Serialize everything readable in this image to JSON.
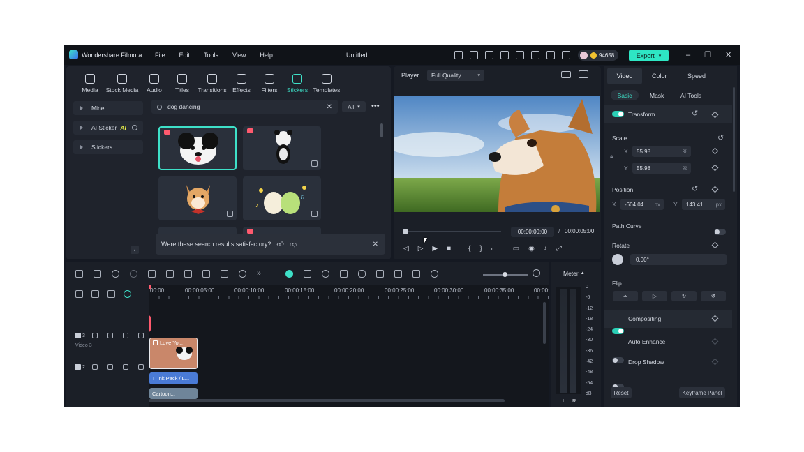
{
  "app": {
    "name": "Wondershare Filmora",
    "doc_title": "Untitled",
    "credits": "94658",
    "export_label": "Export"
  },
  "menu": [
    "File",
    "Edit",
    "Tools",
    "View",
    "Help"
  ],
  "toolbar": [
    {
      "label": "Media",
      "icon": "media-icon"
    },
    {
      "label": "Stock Media",
      "icon": "stock-media-icon"
    },
    {
      "label": "Audio",
      "icon": "audio-icon"
    },
    {
      "label": "Titles",
      "icon": "titles-icon"
    },
    {
      "label": "Transitions",
      "icon": "transitions-icon"
    },
    {
      "label": "Effects",
      "icon": "effects-icon"
    },
    {
      "label": "Filters",
      "icon": "filters-icon"
    },
    {
      "label": "Stickers",
      "icon": "stickers-icon",
      "active": true
    },
    {
      "label": "Templates",
      "icon": "templates-icon"
    }
  ],
  "sidebar": {
    "items": [
      "Mine",
      "AI Sticker",
      "Stickers"
    ],
    "ai_badge": "AI"
  },
  "search": {
    "value": "dog dancing",
    "filter": "All"
  },
  "feedback": {
    "text": "Were these search results satisfactory?"
  },
  "player": {
    "label": "Player",
    "quality": "Full Quality",
    "current_time": "00:00:00:00",
    "separator": "/",
    "total_time": "00:00:05:00"
  },
  "properties": {
    "tabs": [
      "Video",
      "Color",
      "Speed"
    ],
    "subtabs": [
      "Basic",
      "Mask",
      "AI Tools"
    ],
    "transform": "Transform",
    "scale": {
      "label": "Scale",
      "x_label": "X",
      "x": "55.98",
      "y_label": "Y",
      "y": "55.98",
      "unit": "%"
    },
    "position": {
      "label": "Position",
      "x_label": "X",
      "x": "-604.04",
      "y_label": "Y",
      "y": "143.41",
      "unit": "px"
    },
    "path_curve": "Path Curve",
    "rotate": {
      "label": "Rotate",
      "value": "0.00°"
    },
    "flip": "Flip",
    "compositing": "Compositing",
    "auto_enhance": "Auto Enhance",
    "drop_shadow": "Drop Shadow",
    "reset": "Reset",
    "keyframe_panel": "Keyframe Panel"
  },
  "timeline": {
    "ruler": [
      "00:00",
      "00:00:05:00",
      "00:00:10:00",
      "00:00:15:00",
      "00:00:20:00",
      "00:00:25:00",
      "00:00:30:00",
      "00:00:35:00",
      "00:00:"
    ],
    "tracks": [
      {
        "num": "3",
        "name": "Video 3",
        "clip": "Love Yo..."
      },
      {
        "num": "2",
        "clip": "Ink Pack / L..."
      },
      {
        "clip": "Cartoon..."
      }
    ]
  },
  "meter": {
    "label": "Meter",
    "scale": [
      "0",
      "-6",
      "-12",
      "-18",
      "-24",
      "-30",
      "-36",
      "-42",
      "-48",
      "-54",
      "dB"
    ],
    "channels": [
      "L",
      "R"
    ]
  },
  "colors": {
    "accent": "#2bcfb6",
    "export": "#2ee6c4",
    "clip_video": "#c9876a",
    "clip_title": "#4a7bd6",
    "playhead": "#ff5a6e"
  }
}
